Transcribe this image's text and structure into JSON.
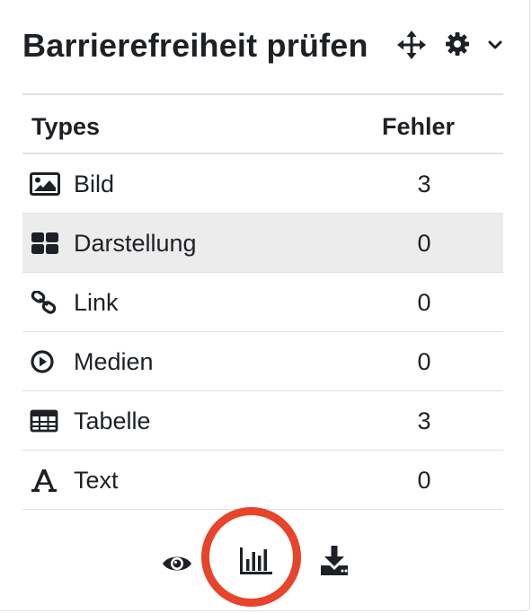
{
  "block": {
    "title": "Barrierefreiheit prüfen"
  },
  "table": {
    "headers": {
      "types": "Types",
      "errors": "Fehler"
    },
    "rows": [
      {
        "label": "Bild",
        "count": "3",
        "icon": "image-icon"
      },
      {
        "label": "Darstellung",
        "count": "0",
        "icon": "layout-grid-icon"
      },
      {
        "label": "Link",
        "count": "0",
        "icon": "link-icon"
      },
      {
        "label": "Medien",
        "count": "0",
        "icon": "play-circle-icon"
      },
      {
        "label": "Tabelle",
        "count": "3",
        "icon": "table-icon"
      },
      {
        "label": "Text",
        "count": "0",
        "icon": "font-icon"
      }
    ]
  },
  "footer": {
    "icons": [
      "eye-icon",
      "bar-chart-icon",
      "download-icon"
    ]
  },
  "colors": {
    "text": "#1d2125",
    "border": "#dee2e6",
    "hover_row": "#ececec",
    "highlight": "#e8432b"
  }
}
